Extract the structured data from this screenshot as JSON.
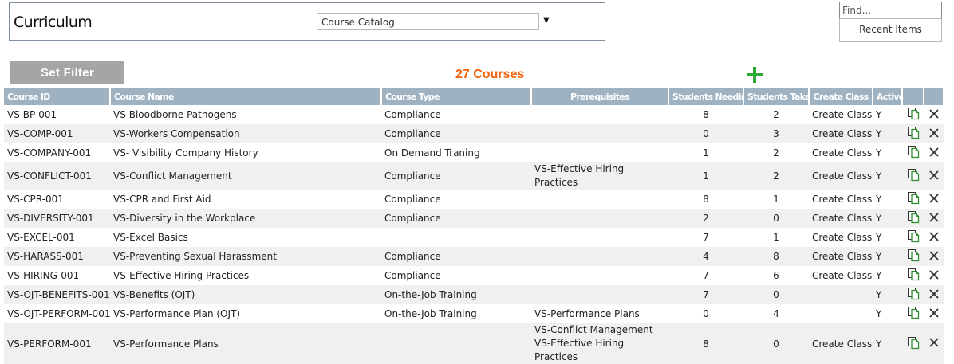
{
  "header": {
    "title": "Curriculum",
    "catalog_select": "Course Catalog",
    "find_placeholder": "Find...",
    "recent_items_label": "Recent Items"
  },
  "toolbar": {
    "set_filter_label": "Set Filter",
    "course_count": "27 Courses"
  },
  "colors": {
    "accent_orange": "#f4620d",
    "header_blue_gray": "#9fb2c2",
    "link_rust": "#b5532a",
    "add_green": "#2ea836"
  },
  "table": {
    "columns": [
      "Course ID",
      "Course Name",
      "Course Type",
      "Prerequisites",
      "Students Needing",
      "Students Taken",
      "Create Class",
      "Active"
    ],
    "rows": [
      {
        "id": "VS-BP-001",
        "name": "VS-Bloodborne Pathogens",
        "type": "Compliance",
        "prereqs": [],
        "needing": "8",
        "taken": "2",
        "create": "Create Class",
        "active": "Y"
      },
      {
        "id": "VS-COMP-001",
        "name": "VS-Workers Compensation",
        "type": "Compliance",
        "prereqs": [],
        "needing": "0",
        "taken": "3",
        "create": "Create Class",
        "active": "Y"
      },
      {
        "id": "VS-COMPANY-001",
        "name": "VS- Visibility Company History",
        "type": "On Demand Traning",
        "prereqs": [],
        "needing": "1",
        "taken": "2",
        "create": "Create Class",
        "active": "Y"
      },
      {
        "id": "VS-CONFLICT-001",
        "name": "VS-Conflict Management",
        "type": "Compliance",
        "prereqs": [
          "VS-Effective Hiring Practices"
        ],
        "needing": "1",
        "taken": "2",
        "create": "Create Class",
        "active": "Y"
      },
      {
        "id": "VS-CPR-001",
        "name": "VS-CPR and First Aid",
        "type": "Compliance",
        "prereqs": [],
        "needing": "8",
        "taken": "1",
        "create": "Create Class",
        "active": "Y"
      },
      {
        "id": "VS-DIVERSITY-001",
        "name": "VS-Diversity in the Workplace",
        "type": "Compliance",
        "prereqs": [],
        "needing": "2",
        "taken": "0",
        "create": "Create Class",
        "active": "Y"
      },
      {
        "id": "VS-EXCEL-001",
        "name": "VS-Excel Basics",
        "type": "",
        "prereqs": [],
        "needing": "7",
        "taken": "1",
        "create": "Create Class",
        "active": "Y"
      },
      {
        "id": "VS-HARASS-001",
        "name": "VS-Preventing Sexual Harassment",
        "type": "Compliance",
        "prereqs": [],
        "needing": "4",
        "taken": "8",
        "create": "Create Class",
        "active": "Y"
      },
      {
        "id": "VS-HIRING-001",
        "name": "VS-Effective Hiring Practices",
        "type": "Compliance",
        "prereqs": [],
        "needing": "7",
        "taken": "6",
        "create": "Create Class",
        "active": "Y"
      },
      {
        "id": "VS-OJT-BENEFITS-001",
        "name": "VS-Benefits (OJT)",
        "type": "On-the-Job Training",
        "prereqs": [],
        "needing": "7",
        "taken": "0",
        "create": "",
        "active": "Y"
      },
      {
        "id": "VS-OJT-PERFORM-001",
        "name": "VS-Performance Plan (OJT)",
        "type": "On-the-Job Training",
        "prereqs": [
          "VS-Performance Plans"
        ],
        "needing": "0",
        "taken": "4",
        "create": "",
        "active": "Y"
      },
      {
        "id": "VS-PERFORM-001",
        "name": "VS-Performance Plans",
        "type": "",
        "prereqs": [
          "VS-Conflict Management",
          "VS-Effective Hiring Practices"
        ],
        "needing": "8",
        "taken": "0",
        "create": "Create Class",
        "active": "Y"
      }
    ]
  }
}
